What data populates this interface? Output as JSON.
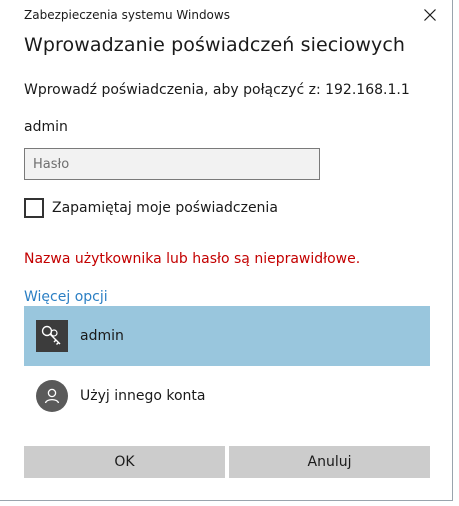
{
  "window": {
    "title": "Zabezpieczenia systemu Windows",
    "close_icon": "close-icon"
  },
  "dialog": {
    "heading": "Wprowadzanie poświadczeń sieciowych",
    "connect_text": "Wprowadź poświadczenia, aby połączyć z: 192.168.1.1",
    "username": "admin",
    "password": {
      "value": "",
      "placeholder": "Hasło"
    },
    "remember": {
      "label": "Zapamiętaj moje poświadczenia",
      "checked": false
    },
    "error": "Nazwa użytkownika lub hasło są nieprawidłowe.",
    "more_options": "Więcej opcji",
    "accounts": [
      {
        "label": "admin",
        "icon": "key-icon",
        "selected": true
      },
      {
        "label": "Użyj innego konta",
        "icon": "person-icon",
        "selected": false
      }
    ],
    "buttons": {
      "ok": "OK",
      "cancel": "Anuluj"
    }
  },
  "colors": {
    "error": "#c30000",
    "link": "#2b7fc4",
    "selected_account": "#99c6dd",
    "button": "#cccccc"
  }
}
